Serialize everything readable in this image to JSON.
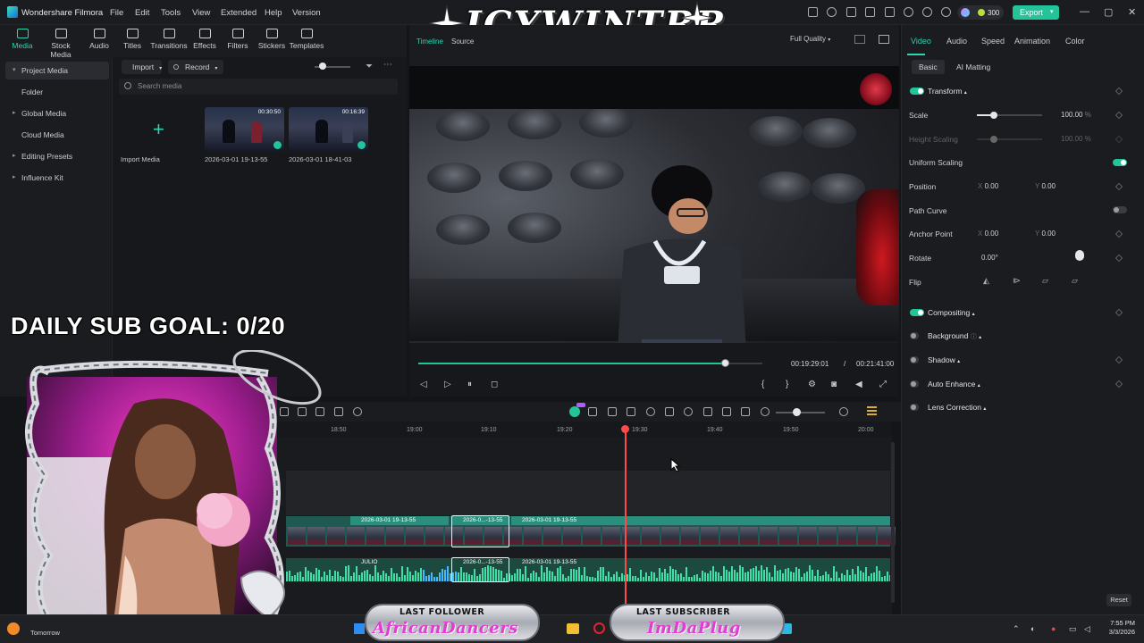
{
  "titlebar": {
    "app_name": "Wondershare Filmora",
    "menus": [
      "File",
      "Edit",
      "Tools",
      "View",
      "Extended",
      "Help",
      "Version"
    ],
    "credits": "300",
    "export_label": "Export"
  },
  "overlay_logo": "ICYWINTRR",
  "media_toolbar": {
    "items": [
      "Media",
      "Stock Media",
      "Audio",
      "Titles",
      "Transitions",
      "Effects",
      "Filters",
      "Stickers",
      "Templates"
    ]
  },
  "sidebar": {
    "items": [
      "Project Media",
      "Folder",
      "Global Media",
      "Cloud Media",
      "Editing Presets",
      "Influence Kit"
    ]
  },
  "media": {
    "import_label": "Import",
    "record_label": "Record",
    "search_placeholder": "Search media",
    "import_media_label": "Import Media",
    "clips": [
      {
        "name": "2026-03-01 19-13-55",
        "duration": "00:30:50"
      },
      {
        "name": "2026-03-01 18-41-03",
        "duration": "00:16:39"
      }
    ]
  },
  "player": {
    "tabs": [
      "Timeline",
      "Source"
    ],
    "quality": "Full Quality",
    "current_time": "00:19:29:01",
    "separator": "/",
    "total_time": "00:21:41:00",
    "progress": 0.89
  },
  "properties": {
    "tabs": [
      "Video",
      "Audio",
      "Speed",
      "Animation",
      "Color"
    ],
    "subtabs": [
      "Basic",
      "AI Matting"
    ],
    "transform_label": "Transform",
    "scale_label": "Scale",
    "scale_value": "100.00",
    "scale_unit": "%",
    "height_scaling_label": "Height Scaling",
    "height_scaling_value": "100.00",
    "uniform_scaling_label": "Uniform Scaling",
    "position_label": "Position",
    "position_x": "0.00",
    "position_y": "0.00",
    "path_curve_label": "Path Curve",
    "anchor_label": "Anchor Point",
    "anchor_x": "0.00",
    "anchor_y": "0.00",
    "rotate_label": "Rotate",
    "rotate_value": "0.00°",
    "flip_label": "Flip",
    "x_label": "X",
    "y_label": "Y",
    "compositing_label": "Compositing",
    "background_label": "Background",
    "shadow_label": "Shadow",
    "auto_enhance_label": "Auto Enhance",
    "lens_correction_label": "Lens Correction",
    "reset_label": "Reset"
  },
  "timeline": {
    "ticks": [
      "18:50",
      "19:00",
      "19:10",
      "19:20",
      "19:30",
      "19:40",
      "19:50",
      "20:00"
    ],
    "video_clips": [
      "2026-03-01 19-13-55",
      "2026-0...-13-55",
      "2026-03-01 19-13-55"
    ],
    "audio_clips": [
      "JULIO",
      "2026-0...-13-55",
      "2026-03-01 19-13-55"
    ]
  },
  "stream": {
    "sub_goal": "DAILY SUB GOAL: 0/20",
    "last_follower_title": "LAST FOLLOWER",
    "last_follower_name": "AfricanDancers",
    "last_subscriber_title": "LAST SUBSCRIBER",
    "last_subscriber_name": "ImDaPlug"
  },
  "taskbar": {
    "weather_label": "Tomorrow",
    "time": "7:55 PM",
    "date": "3/3/2026"
  },
  "colors": {
    "accent": "#24c49a",
    "playhead": "#ff4a4a",
    "panel": "#1b1c20"
  }
}
